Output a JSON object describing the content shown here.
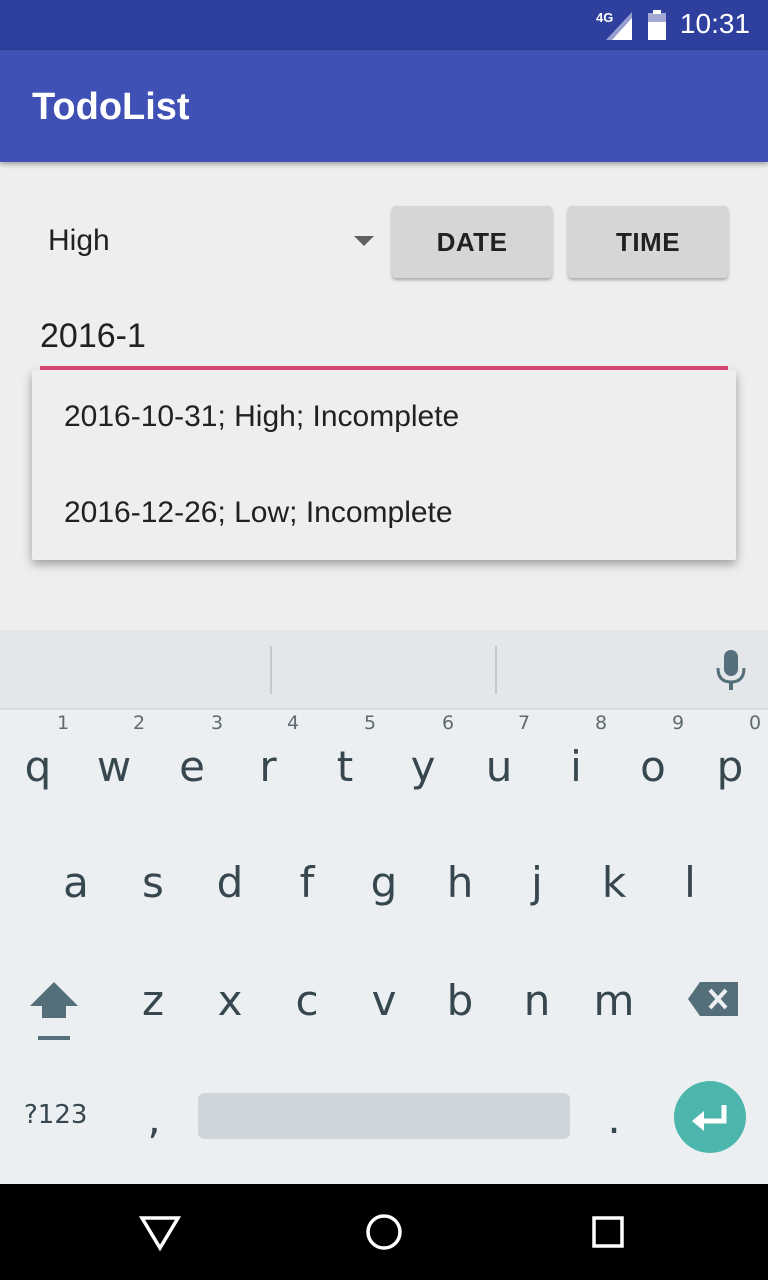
{
  "status_bar": {
    "network": "4G",
    "time": "10:31"
  },
  "app_bar": {
    "title": "TodoList"
  },
  "form": {
    "priority": "High",
    "date_button": "DATE",
    "time_button": "TIME",
    "date_value": "2016-1"
  },
  "suggestions": [
    "2016-10-31; High; Incomplete",
    "2016-12-26; Low; Incomplete"
  ],
  "keyboard": {
    "row1": [
      "q",
      "w",
      "e",
      "r",
      "t",
      "y",
      "u",
      "i",
      "o",
      "p"
    ],
    "row1_hints": [
      "1",
      "2",
      "3",
      "4",
      "5",
      "6",
      "7",
      "8",
      "9",
      "0"
    ],
    "row2": [
      "a",
      "s",
      "d",
      "f",
      "g",
      "h",
      "j",
      "k",
      "l"
    ],
    "row3": [
      "z",
      "x",
      "c",
      "v",
      "b",
      "n",
      "m"
    ],
    "symbols": "?123",
    "comma": ",",
    "period": "."
  },
  "colors": {
    "app_bar": "#3f51b5",
    "status_bar": "#2f3f9e",
    "underline": "#e04673",
    "enter": "#4db6ac"
  }
}
